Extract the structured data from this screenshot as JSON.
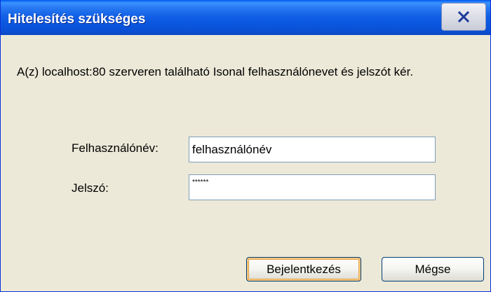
{
  "window": {
    "title": "Hitelesítés szükséges"
  },
  "titlebar": {
    "close_icon": "close-x-icon"
  },
  "dialog": {
    "message": "A(z) localhost:80 szerveren található Isonal felhasználónevet és jelszót kér.",
    "username": {
      "label": "Felhasználónév:",
      "value": "felhasználónév"
    },
    "password": {
      "label": "Jelszó:",
      "value": "******"
    },
    "buttons": {
      "login": "Bejelentkezés",
      "cancel": "Mégse"
    }
  }
}
